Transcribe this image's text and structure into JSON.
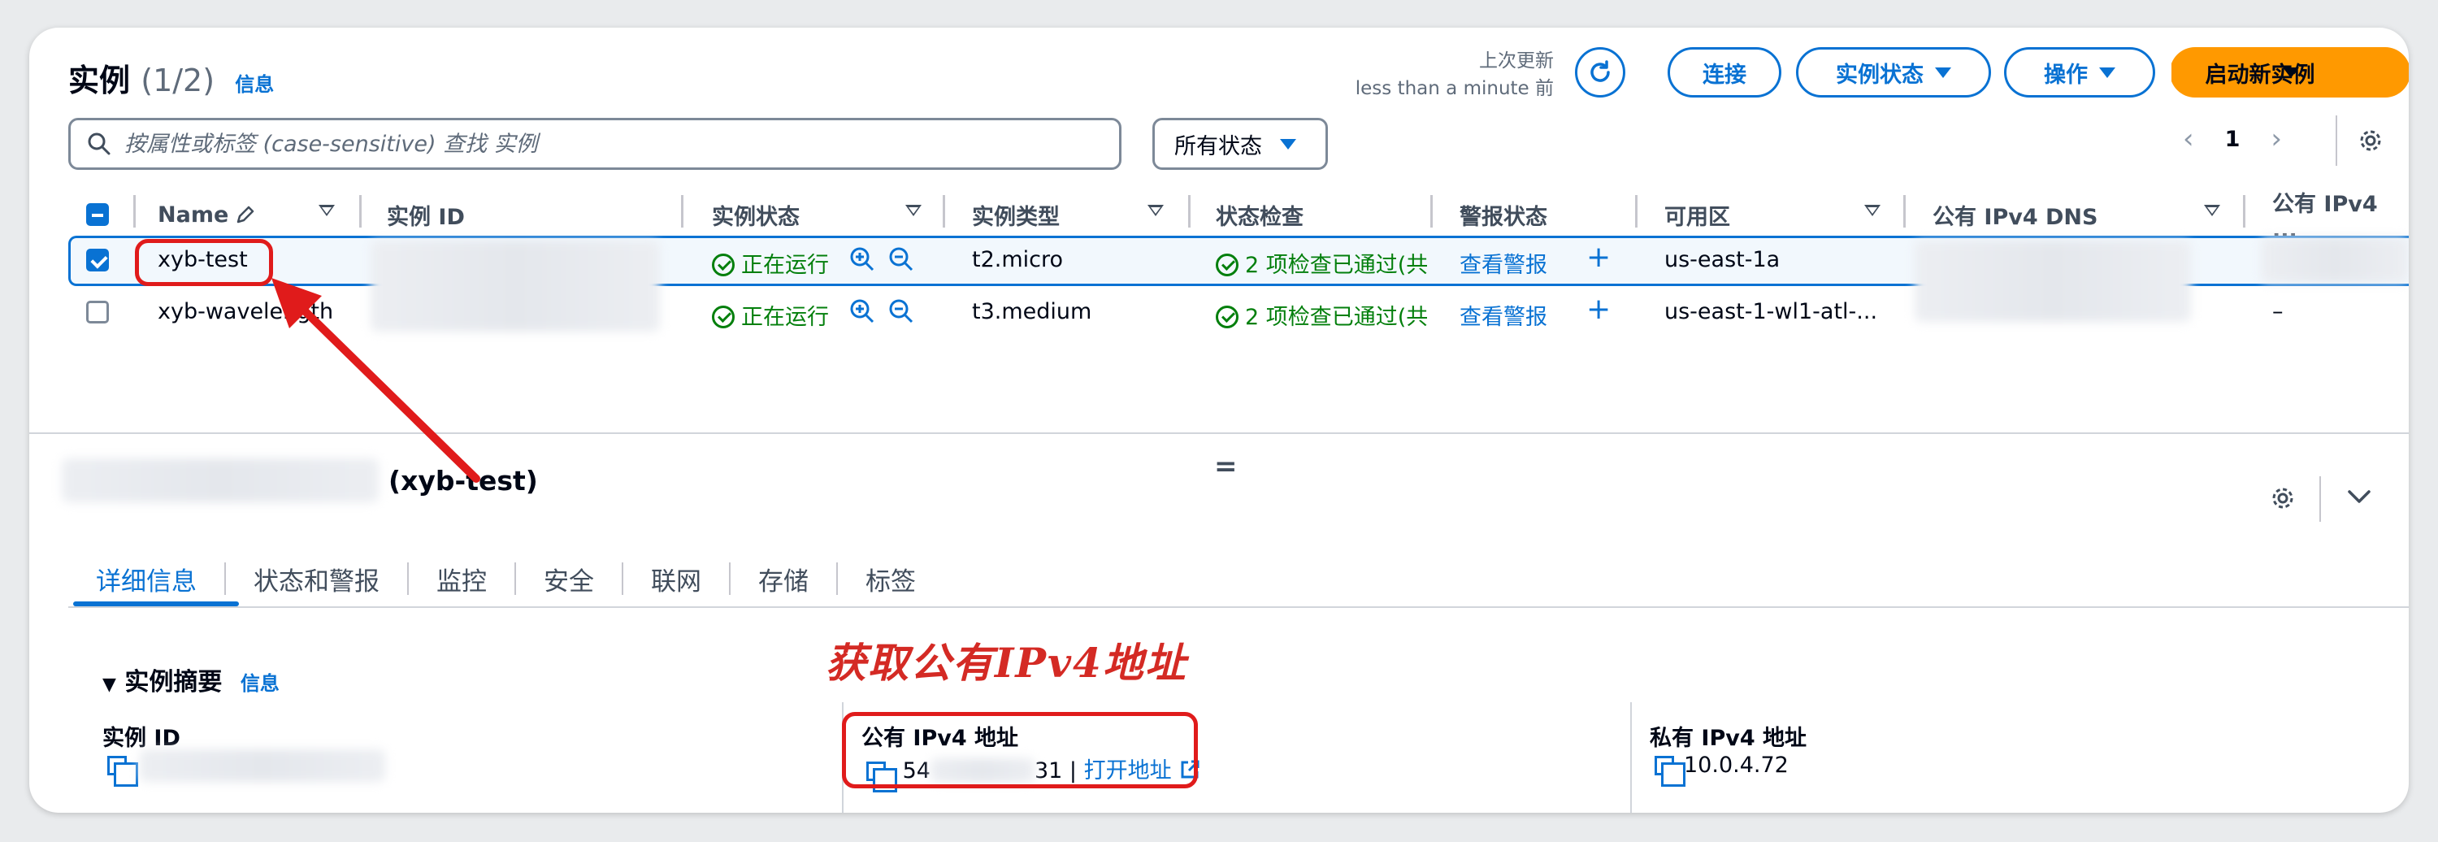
{
  "header": {
    "title": "实例",
    "count": "(1/2)",
    "info": "信息",
    "last_updated_label": "上次更新",
    "last_updated_value": "less than a minute 前",
    "connect": "连接",
    "instance_state": "实例状态",
    "actions": "操作",
    "launch": "启动新实例"
  },
  "search": {
    "placeholder": "按属性或标签 (case-sensitive) 查找 实例"
  },
  "filter": {
    "value": "所有状态"
  },
  "pagination": {
    "page": "1"
  },
  "table": {
    "columns": [
      "Name",
      "实例 ID",
      "实例状态",
      "实例类型",
      "状态检查",
      "警报状态",
      "可用区",
      "公有 IPv4 DNS",
      "公有 IPv4 ..."
    ],
    "rows": [
      {
        "name": "xyb-test",
        "state": "正在运行",
        "type": "t2.micro",
        "check": "2 项检查已通过(共",
        "alarm": "查看警报",
        "az": "us-east-1a",
        "ipv4": "",
        "selected": true
      },
      {
        "name": "xyb-wavelength",
        "state": "正在运行",
        "type": "t3.medium",
        "check": "2 项检查已通过(共",
        "alarm": "查看警报",
        "az": "us-east-1-wl1-atl-...",
        "ipv4": "–",
        "selected": false
      }
    ]
  },
  "details": {
    "title": "(xyb-test)",
    "tabs": [
      "详细信息",
      "状态和警报",
      "监控",
      "安全",
      "联网",
      "存储",
      "标签"
    ],
    "section": "实例摘要",
    "section_info": "信息",
    "instance_id_label": "实例 ID",
    "public_ipv4_label": "公有 IPv4 地址",
    "public_ipv4_prefix": "54",
    "public_ipv4_suffix": "31",
    "open_address": "打开地址",
    "private_ipv4_label": "私有 IPv4 地址",
    "private_ipv4_value": "10.0.4.72"
  },
  "annotation": "获取公有IPv4地址",
  "colors": {
    "primary": "#0972d3",
    "accent": "#ff9900",
    "success": "#037f0c",
    "annotation": "#e01b1b"
  }
}
